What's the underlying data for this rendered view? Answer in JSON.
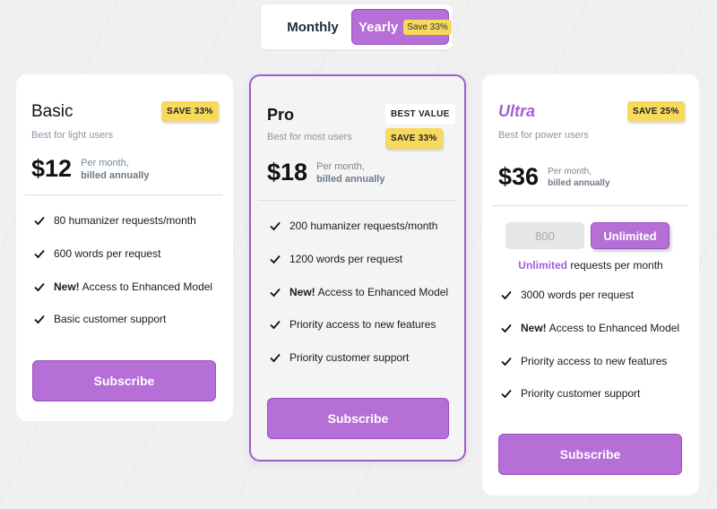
{
  "billing_toggle": {
    "monthly_label": "Monthly",
    "yearly_label": "Yearly",
    "yearly_save": "Save 33%"
  },
  "plans": [
    {
      "name": "Basic",
      "badge": "SAVE 33%",
      "subtitle": "Best for light users",
      "price": "$12",
      "price_note_1": "Per month,",
      "price_note_2": "billed annually",
      "features": [
        {
          "prefix": "",
          "text": "80 humanizer requests/month"
        },
        {
          "prefix": "",
          "text": "600 words per request"
        },
        {
          "prefix": "New!",
          "text": "Access to Enhanced Model"
        },
        {
          "prefix": "",
          "text": "Basic customer support"
        }
      ],
      "button": "Subscribe"
    },
    {
      "name": "Pro",
      "best_value": "BEST VALUE",
      "badge": "SAVE 33%",
      "subtitle": "Best for most users",
      "price": "$18",
      "price_note_1": "Per month,",
      "price_note_2": "billed annually",
      "features": [
        {
          "prefix": "",
          "text": "200 humanizer requests/month"
        },
        {
          "prefix": "",
          "text": "1200 words per request"
        },
        {
          "prefix": "New!",
          "text": "Access to Enhanced Model"
        },
        {
          "prefix": "",
          "text": "Priority access to new features"
        },
        {
          "prefix": "",
          "text": "Priority customer support"
        }
      ],
      "button": "Subscribe"
    },
    {
      "name": "Ultra",
      "badge": "SAVE 25%",
      "subtitle": "Best for power users",
      "price": "$36",
      "price_note_1": "Per month,",
      "price_note_2": "billed annually",
      "request_options": [
        "800",
        "Unlimited"
      ],
      "request_selected": "Unlimited",
      "request_suffix": "requests per month",
      "features": [
        {
          "prefix": "",
          "text": "3000 words per request"
        },
        {
          "prefix": "New!",
          "text": "Access to Enhanced Model"
        },
        {
          "prefix": "",
          "text": "Priority access to new features"
        },
        {
          "prefix": "",
          "text": "Priority customer support"
        }
      ],
      "button": "Subscribe"
    }
  ],
  "colors": {
    "accent": "#b56fd6",
    "badge": "#f7d95d",
    "background": "#f0f0f0"
  }
}
